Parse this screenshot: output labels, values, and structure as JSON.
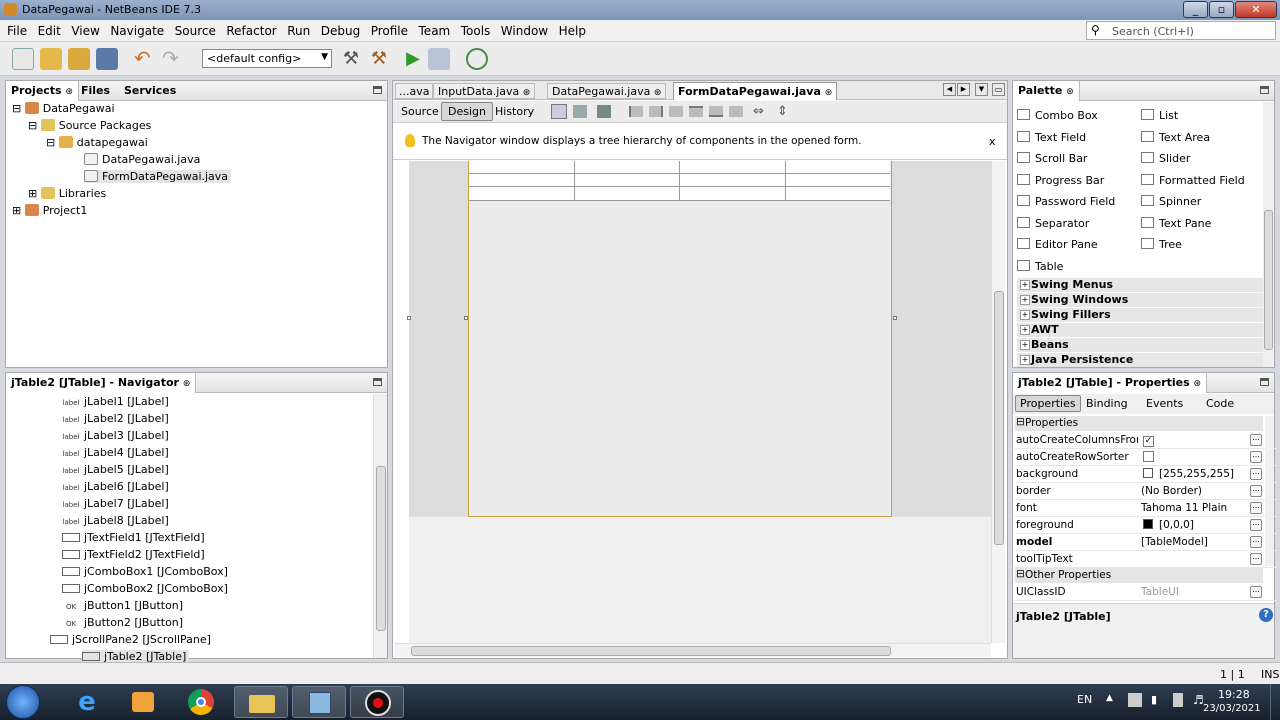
{
  "window": {
    "title": "DataPegawai - NetBeans IDE 7.3"
  },
  "menu": [
    "File",
    "Edit",
    "View",
    "Navigate",
    "Source",
    "Refactor",
    "Run",
    "Debug",
    "Profile",
    "Team",
    "Tools",
    "Window",
    "Help"
  ],
  "search": {
    "placeholder": "Search (Ctrl+I)"
  },
  "toolbar": {
    "config": "<default config>"
  },
  "projects_panel": {
    "tabs": [
      "Projects",
      "Files",
      "Services"
    ],
    "tree": [
      "DataPegawai",
      "Source Packages",
      "datapegawai",
      "DataPegawai.java",
      "FormDataPegawai.java",
      "Libraries",
      "Project1"
    ]
  },
  "navigator": {
    "title": "jTable2 [JTable] - Navigator",
    "items": [
      {
        "tag": "label",
        "text": "jLabel1 [JLabel]"
      },
      {
        "tag": "label",
        "text": "jLabel2 [JLabel]"
      },
      {
        "tag": "label",
        "text": "jLabel3 [JLabel]"
      },
      {
        "tag": "label",
        "text": "jLabel4 [JLabel]"
      },
      {
        "tag": "label",
        "text": "jLabel5 [JLabel]"
      },
      {
        "tag": "label",
        "text": "jLabel6 [JLabel]"
      },
      {
        "tag": "label",
        "text": "jLabel7 [JLabel]"
      },
      {
        "tag": "label",
        "text": "jLabel8 [JLabel]"
      },
      {
        "tag": "",
        "text": "jTextField1 [JTextField]"
      },
      {
        "tag": "",
        "text": "jTextField2 [JTextField]"
      },
      {
        "tag": "",
        "text": "jComboBox1 [JComboBox]"
      },
      {
        "tag": "",
        "text": "jComboBox2 [JComboBox]"
      },
      {
        "tag": "OK",
        "text": "jButton1 [JButton]"
      },
      {
        "tag": "OK",
        "text": "jButton2 [JButton]"
      },
      {
        "tag": "",
        "text": "jScrollPane2 [JScrollPane]"
      },
      {
        "tag": "",
        "text": "jTable2 [JTable]"
      }
    ]
  },
  "editor": {
    "tabs": [
      "...ava",
      "InputData.java",
      "DataPegawai.java",
      "FormDataPegawai.java"
    ],
    "modes": [
      "Source",
      "Design",
      "History"
    ],
    "hint": "The Navigator window displays a tree hierarchy of components in the opened form.",
    "hint_close": "x"
  },
  "palette": {
    "title": "Palette",
    "items_left": [
      "Combo Box",
      "Text Field",
      "Scroll Bar",
      "Progress Bar",
      "Password Field",
      "Separator",
      "Editor Pane",
      "Table"
    ],
    "items_right": [
      "List",
      "Text Area",
      "Slider",
      "Formatted Field",
      "Spinner",
      "Text Pane",
      "Tree"
    ],
    "categories": [
      "Swing Menus",
      "Swing Windows",
      "Swing Fillers",
      "AWT",
      "Beans",
      "Java Persistence"
    ]
  },
  "properties": {
    "title": "jTable2 [JTable] - Properties",
    "tabs": [
      "Properties",
      "Binding",
      "Events",
      "Code"
    ],
    "section1": "Properties",
    "rows": [
      {
        "key": "autoCreateColumnsFromMo",
        "value": ""
      },
      {
        "key": "autoCreateRowSorter",
        "value": ""
      },
      {
        "key": "background",
        "value": "[255,255,255]"
      },
      {
        "key": "border",
        "value": "(No Border)"
      },
      {
        "key": "font",
        "value": "Tahoma 11 Plain"
      },
      {
        "key": "foreground",
        "value": "[0,0,0]"
      },
      {
        "key": "model",
        "value": "[TableModel]"
      },
      {
        "key": "toolTipText",
        "value": ""
      }
    ],
    "section2": "Other Properties",
    "uiclass": {
      "key": "UIClassID",
      "value": "TableUI"
    },
    "footer": "jTable2 [JTable]"
  },
  "status": {
    "pos": "1 | 1",
    "mode": "INS"
  },
  "tray": {
    "lang": "EN",
    "time": "19:28",
    "date": "23/03/2021"
  }
}
